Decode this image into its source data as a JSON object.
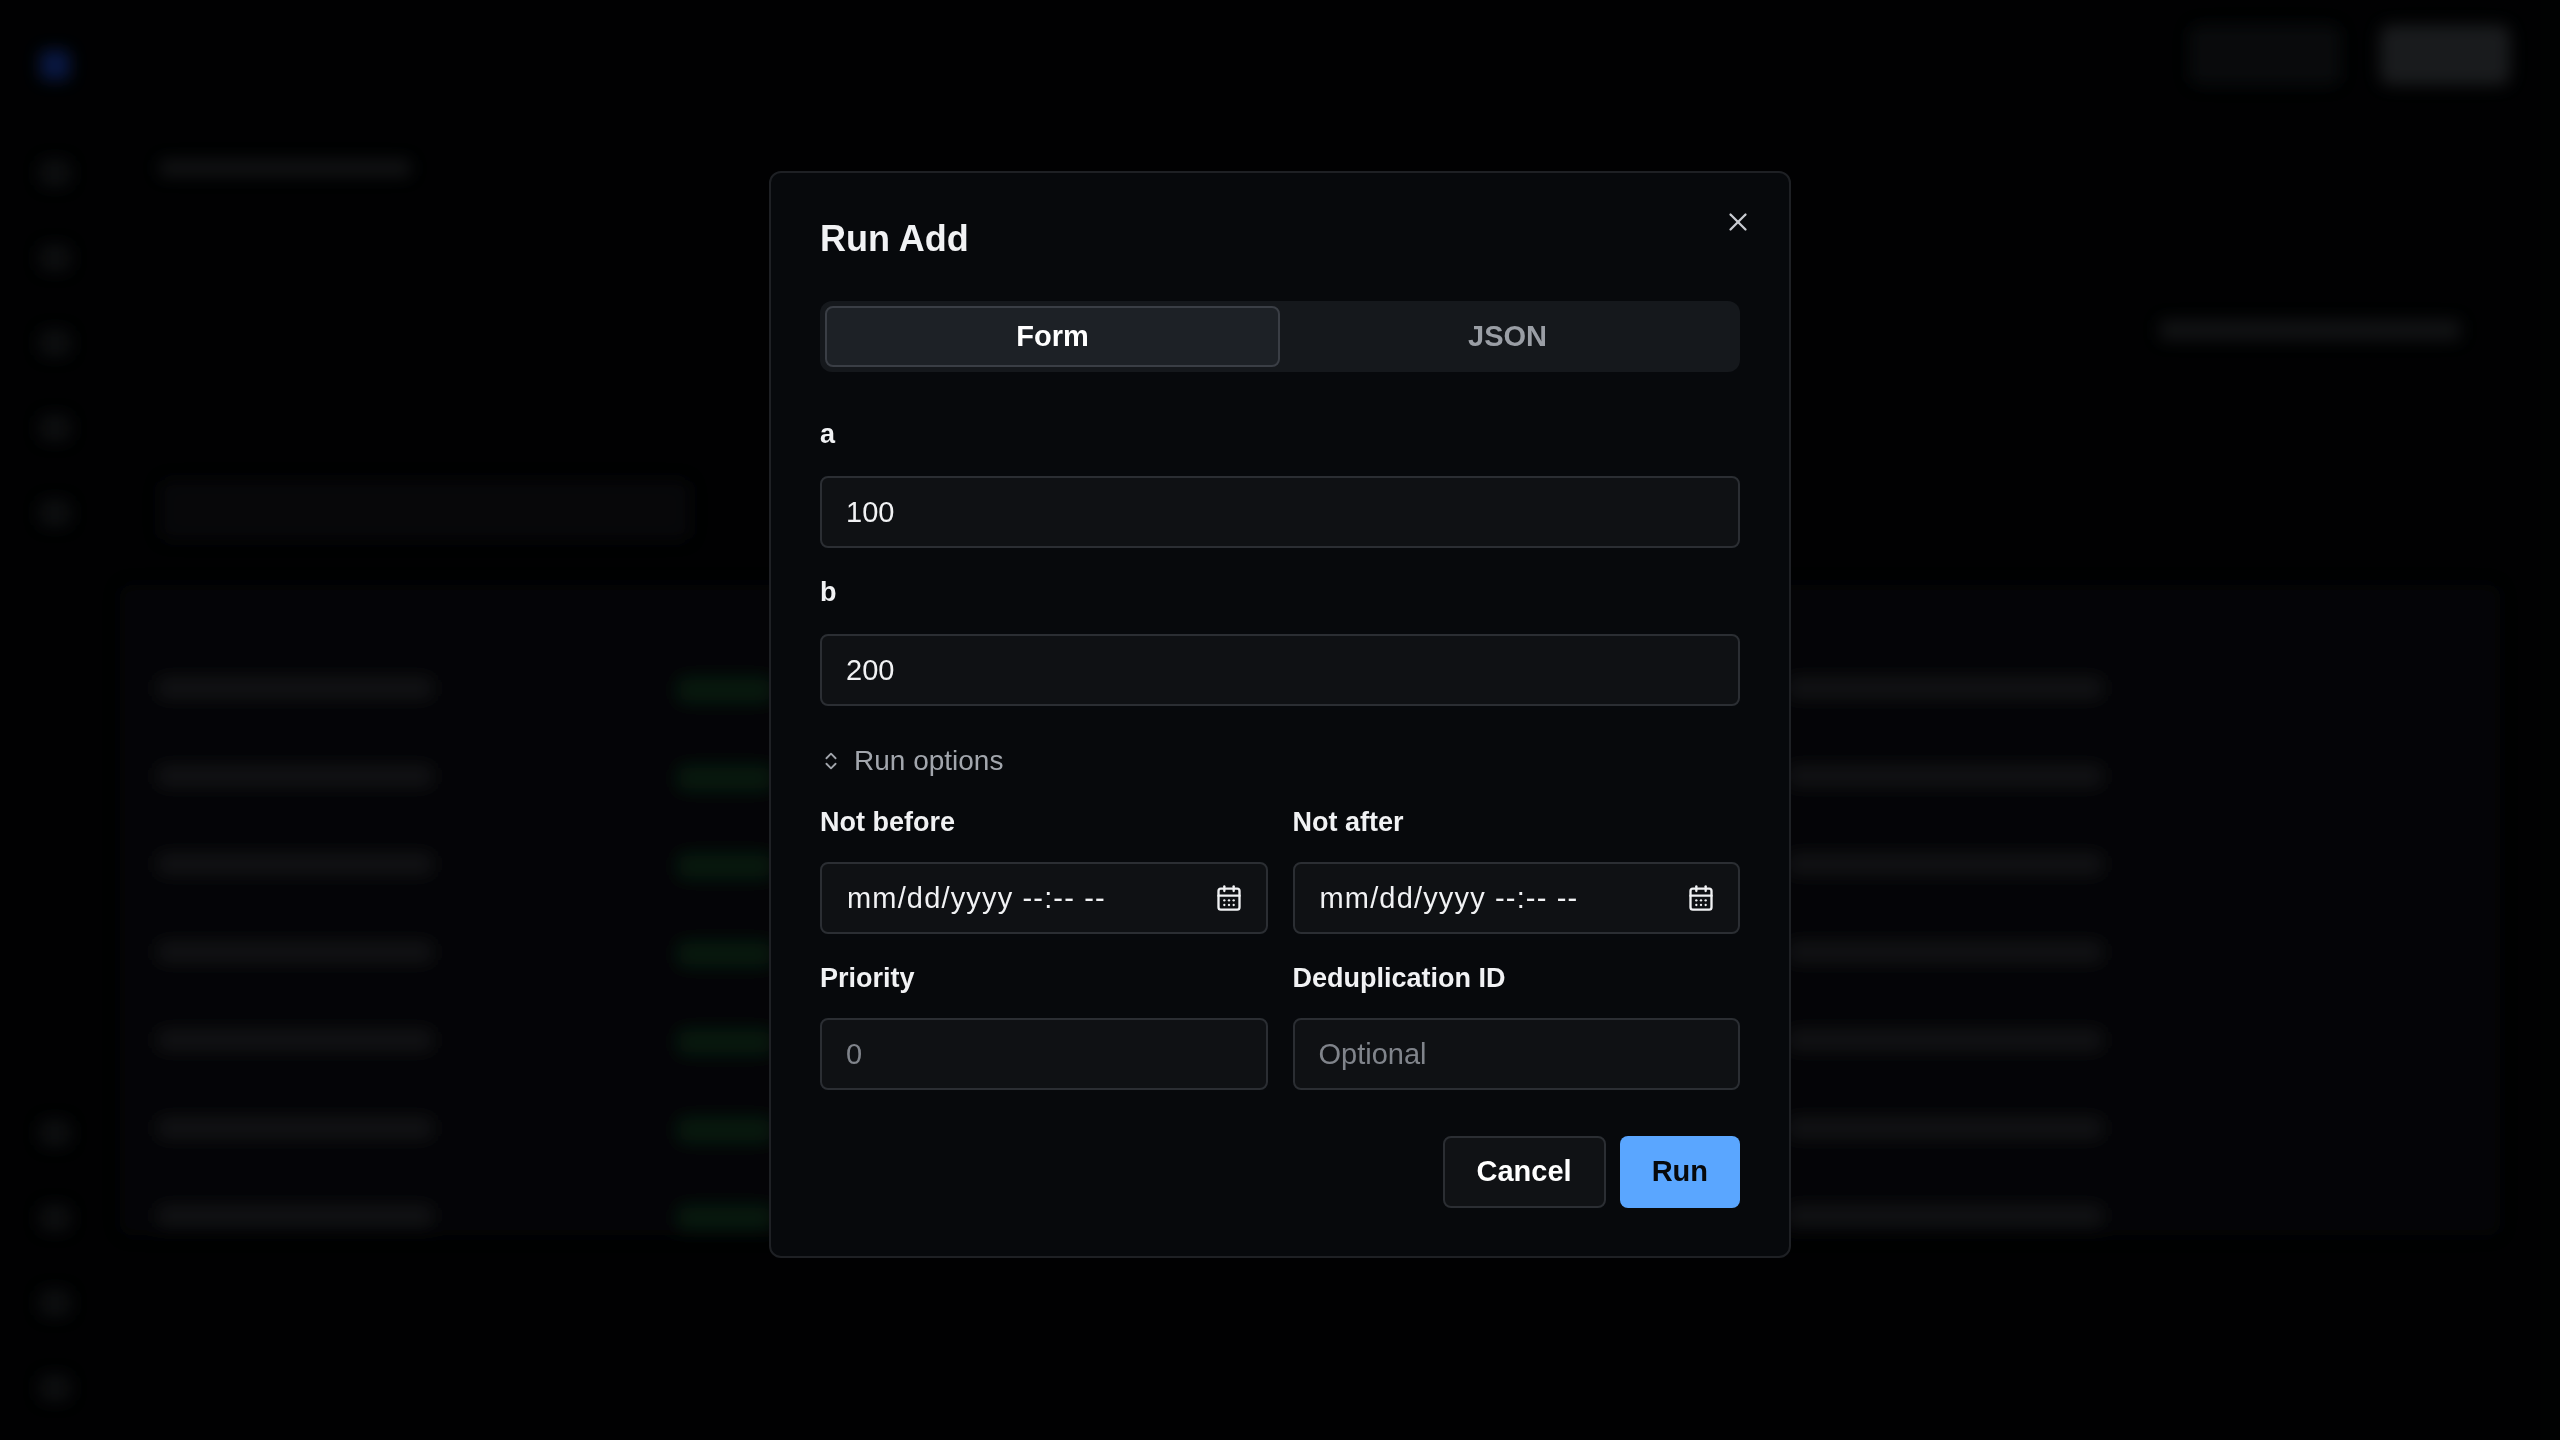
{
  "dialog": {
    "title": "Run Add",
    "tabs": [
      {
        "label": "Form",
        "selected": true
      },
      {
        "label": "JSON",
        "selected": false
      }
    ],
    "fields": [
      {
        "label": "a",
        "value": "100"
      },
      {
        "label": "b",
        "value": "200"
      }
    ],
    "run_options": {
      "label": "Run options",
      "expanded": true
    },
    "options": [
      {
        "kind": "datetime",
        "label": "Not before",
        "placeholder": "mm/dd/yyyy --:-- --"
      },
      {
        "kind": "datetime",
        "label": "Not after",
        "placeholder": "mm/dd/yyyy --:-- --"
      },
      {
        "kind": "text",
        "label": "Priority",
        "placeholder": "0"
      },
      {
        "kind": "text",
        "label": "Deduplication ID",
        "placeholder": "Optional"
      }
    ],
    "buttons": [
      {
        "label": "Cancel",
        "kind": "secondary"
      },
      {
        "label": "Run",
        "kind": "primary"
      }
    ]
  }
}
